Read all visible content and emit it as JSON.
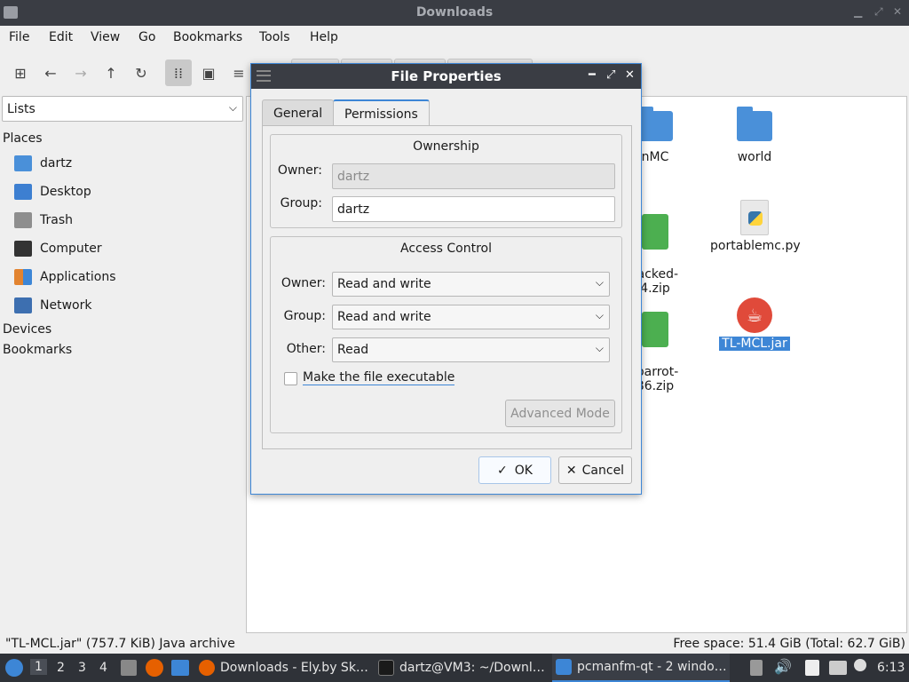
{
  "window": {
    "title": "Downloads"
  },
  "menu": [
    "File",
    "Edit",
    "View",
    "Go",
    "Bookmarks",
    "Tools",
    "Help"
  ],
  "sidebar": {
    "view_select": "Lists",
    "places_header": "Places",
    "items": [
      {
        "label": "dartz",
        "icon": "home-folder-icon",
        "color": "#4a90d9"
      },
      {
        "label": "Desktop",
        "icon": "desktop-icon",
        "color": "#3d7fd1"
      },
      {
        "label": "Trash",
        "icon": "trash-icon",
        "color": "#8e8e8e"
      },
      {
        "label": "Computer",
        "icon": "computer-icon",
        "color": "#333333"
      },
      {
        "label": "Applications",
        "icon": "applications-icon",
        "color": "#e2832f"
      },
      {
        "label": "Network",
        "icon": "network-icon",
        "color": "#3d6fb0"
      }
    ],
    "devices_header": "Devices",
    "bookmarks_header": "Bookmarks"
  },
  "files": [
    {
      "label": "nMC",
      "icon": "folder-icon"
    },
    {
      "label": "world",
      "icon": "folder-icon"
    },
    {
      "label": "racked-\n4.zip",
      "icon": "zip-icon"
    },
    {
      "label": "portablemc.py",
      "icon": "python-icon"
    },
    {
      "label": "-parrot-\n86.zip",
      "icon": "zip-icon"
    },
    {
      "label": "TL-MCL.jar",
      "icon": "java-icon",
      "selected": true
    }
  ],
  "status": {
    "left": "\"TL-MCL.jar\" (757.7 KiB) Java archive",
    "right": "Free space: 51.4 GiB (Total: 62.7 GiB)"
  },
  "dialog": {
    "title": "File Properties",
    "tabs": [
      "General",
      "Permissions"
    ],
    "active_tab": "Permissions",
    "ownership": {
      "title": "Ownership",
      "owner_label": "Owner:",
      "owner_value": "dartz",
      "group_label": "Group:",
      "group_value": "dartz"
    },
    "access": {
      "title": "Access Control",
      "owner_label": "Owner:",
      "owner_value": "Read and write",
      "group_label": "Group:",
      "group_value": "Read and write",
      "other_label": "Other:",
      "other_value": "Read",
      "executable_label": "Make the file executable",
      "advanced_label": "Advanced Mode"
    },
    "ok_label": "OK",
    "cancel_label": "Cancel"
  },
  "taskbar": {
    "workspaces": [
      "1",
      "2",
      "3",
      "4"
    ],
    "tasks": [
      {
        "label": "Downloads - Ely.by Sk…"
      },
      {
        "label": "dartz@VM3: ~/Downl…"
      },
      {
        "label": "pcmanfm-qt - 2 windo…"
      }
    ],
    "clock": "6:13"
  },
  "colors": {
    "accent": "#3d86d6",
    "titlebar": "#3a3d44",
    "taskbar": "#2f3238"
  }
}
